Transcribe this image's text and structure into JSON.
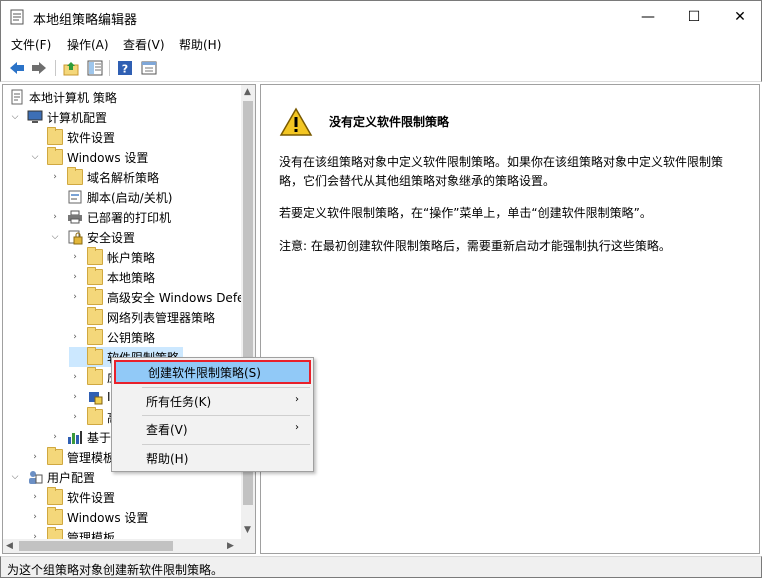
{
  "window": {
    "title": "本地组策略编辑器",
    "min_glyph": "—",
    "max_glyph": "☐",
    "close_glyph": "✕"
  },
  "menubar": [
    {
      "label": "文件(F)"
    },
    {
      "label": "操作(A)"
    },
    {
      "label": "查看(V)"
    },
    {
      "label": "帮助(H)"
    }
  ],
  "toolbar": [
    {
      "icon": "back-arrow-icon"
    },
    {
      "icon": "forward-arrow-icon"
    },
    {
      "icon": "up-folder-icon"
    },
    {
      "icon": "show-hide-tree-icon"
    },
    {
      "icon": "help-icon"
    },
    {
      "icon": "properties-icon"
    }
  ],
  "tree": [
    {
      "label": "本地计算机 策略",
      "icon": "policy-doc-icon"
    },
    {
      "label": "计算机配置",
      "icon": "computer-icon"
    },
    {
      "label": "软件设置",
      "icon": "folder-icon"
    },
    {
      "label": "Windows 设置",
      "icon": "folder-icon"
    },
    {
      "label": "域名解析策略",
      "icon": "folder-icon"
    },
    {
      "label": "脚本(启动/关机)",
      "icon": "script-icon"
    },
    {
      "label": "已部署的打印机",
      "icon": "printer-icon"
    },
    {
      "label": "安全设置",
      "icon": "security-icon"
    },
    {
      "label": "帐户策略",
      "icon": "folder-icon"
    },
    {
      "label": "本地策略",
      "icon": "folder-icon"
    },
    {
      "label": "高级安全 Windows Defe",
      "icon": "folder-icon"
    },
    {
      "label": "网络列表管理器策略",
      "icon": "folder-icon"
    },
    {
      "label": "公钥策略",
      "icon": "folder-icon"
    },
    {
      "label": "软件限制策略",
      "icon": "folder-icon"
    },
    {
      "label": "应",
      "icon": "folder-icon"
    },
    {
      "label": "IP",
      "icon": "ip-security-icon"
    },
    {
      "label": "高",
      "icon": "folder-icon"
    },
    {
      "label": "基于",
      "icon": "chart-icon"
    },
    {
      "label": "管理模板",
      "icon": "folder-icon"
    },
    {
      "label": "用户配置",
      "icon": "user-icon"
    },
    {
      "label": "软件设置",
      "icon": "folder-icon"
    },
    {
      "label": "Windows 设置",
      "icon": "folder-icon"
    },
    {
      "label": "管理模板",
      "icon": "folder-icon"
    }
  ],
  "details": {
    "title": "没有定义软件限制策略",
    "para1": "没有在该组策略对象中定义软件限制策略。如果你在该组策略对象中定义软件限制策略，它们会替代从其他组策略对象继承的策略设置。",
    "para2": "若要定义软件限制策略，在“操作”菜单上，单击“创建软件限制策略”。",
    "para3": "注意: 在最初创建软件限制策略后，需要重新启动才能强制执行这些策略。"
  },
  "context_menu": [
    {
      "label": "创建软件限制策略(S)",
      "submenu": false,
      "highlighted": true
    },
    {
      "label": "所有任务(K)",
      "submenu": true
    },
    {
      "label": "查看(V)",
      "submenu": true
    },
    {
      "label": "帮助(H)",
      "submenu": false
    }
  ],
  "status": "为这个组策略对象创建新软件限制策略。",
  "colors": {
    "highlight": "#91c9f7",
    "highlight_border": "#e8202a",
    "selected": "#cce8ff"
  }
}
